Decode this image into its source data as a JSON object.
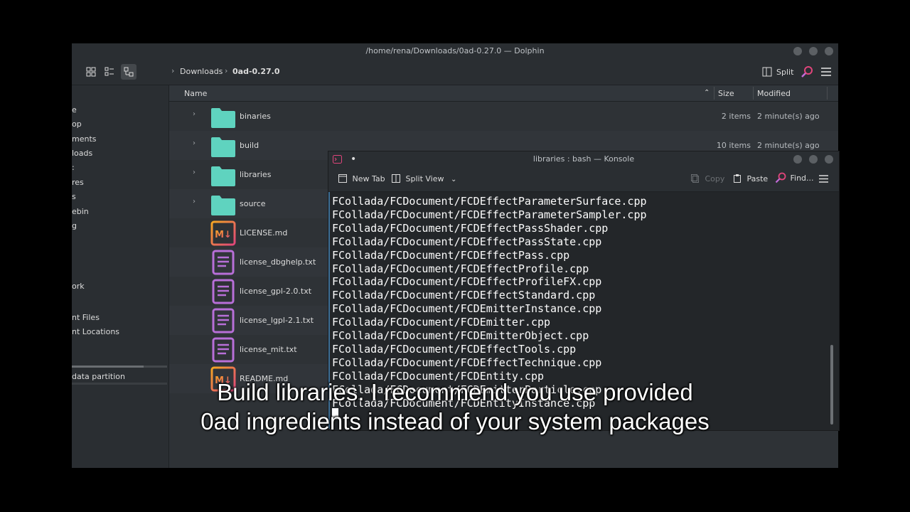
{
  "dolphin": {
    "title": "/home/rena/Downloads/0ad-0.27.0 — Dolphin",
    "breadcrumbs": [
      "Downloads",
      "0ad-0.27.0"
    ],
    "split_label": "Split",
    "columns": {
      "name": "Name",
      "size": "Size",
      "modified": "Modified"
    },
    "sidebar": [
      "e",
      "op",
      "ments",
      "loads",
      ":",
      "res",
      "s",
      "ebin",
      "g",
      "ork",
      "nt Files",
      "nt Locations",
      "data partition"
    ],
    "files": [
      {
        "name": "binaries",
        "type": "folder",
        "size": "2 items",
        "modified": "2 minute(s) ago"
      },
      {
        "name": "build",
        "type": "folder",
        "size": "10 items",
        "modified": "2 minute(s) ago"
      },
      {
        "name": "libraries",
        "type": "folder",
        "size": "",
        "modified": ""
      },
      {
        "name": "source",
        "type": "folder",
        "size": "",
        "modified": ""
      },
      {
        "name": "LICENSE.md",
        "type": "md",
        "size": "",
        "modified": ""
      },
      {
        "name": "license_dbghelp.txt",
        "type": "txt",
        "size": "",
        "modified": ""
      },
      {
        "name": "license_gpl-2.0.txt",
        "type": "txt",
        "size": "",
        "modified": ""
      },
      {
        "name": "license_lgpl-2.1.txt",
        "type": "txt",
        "size": "",
        "modified": ""
      },
      {
        "name": "license_mit.txt",
        "type": "txt",
        "size": "",
        "modified": ""
      },
      {
        "name": "README.md",
        "type": "md",
        "size": "",
        "modified": ""
      }
    ]
  },
  "konsole": {
    "title": "libraries : bash — Konsole",
    "toolbar": {
      "new_tab": "New Tab",
      "split_view": "Split View",
      "copy": "Copy",
      "paste": "Paste",
      "find": "Find..."
    },
    "lines": [
      "FCollada/FCDocument/FCDEffectParameterSurface.cpp",
      "FCollada/FCDocument/FCDEffectParameterSampler.cpp",
      "FCollada/FCDocument/FCDEffectPassShader.cpp",
      "FCollada/FCDocument/FCDEffectPassState.cpp",
      "FCollada/FCDocument/FCDEffectPass.cpp",
      "FCollada/FCDocument/FCDEffectProfile.cpp",
      "FCollada/FCDocument/FCDEffectProfileFX.cpp",
      "FCollada/FCDocument/FCDEffectStandard.cpp",
      "FCollada/FCDocument/FCDEmitterInstance.cpp",
      "FCollada/FCDocument/FCDEmitter.cpp",
      "FCollada/FCDocument/FCDEmitterObject.cpp",
      "FCollada/FCDocument/FCDEffectTools.cpp",
      "FCollada/FCDocument/FCDEffectTechnique.cpp",
      "FCollada/FCDocument/FCDEntity.cpp",
      "FCollada/FCDocument/FCDEmitterParticle.cpp",
      "FCollada/FCDocument/FCDEntityInstance.cpp"
    ]
  },
  "subtitle": {
    "line1": "Build libraries. I recommend you use provided",
    "line2": "0ad ingredients instead of your system packages"
  },
  "colors": {
    "folder": "#5fd3bf",
    "markdown_gradient": [
      "#f5a623",
      "#e0457b"
    ],
    "text_file": "#b86fd8",
    "accent": "#3daee9"
  }
}
